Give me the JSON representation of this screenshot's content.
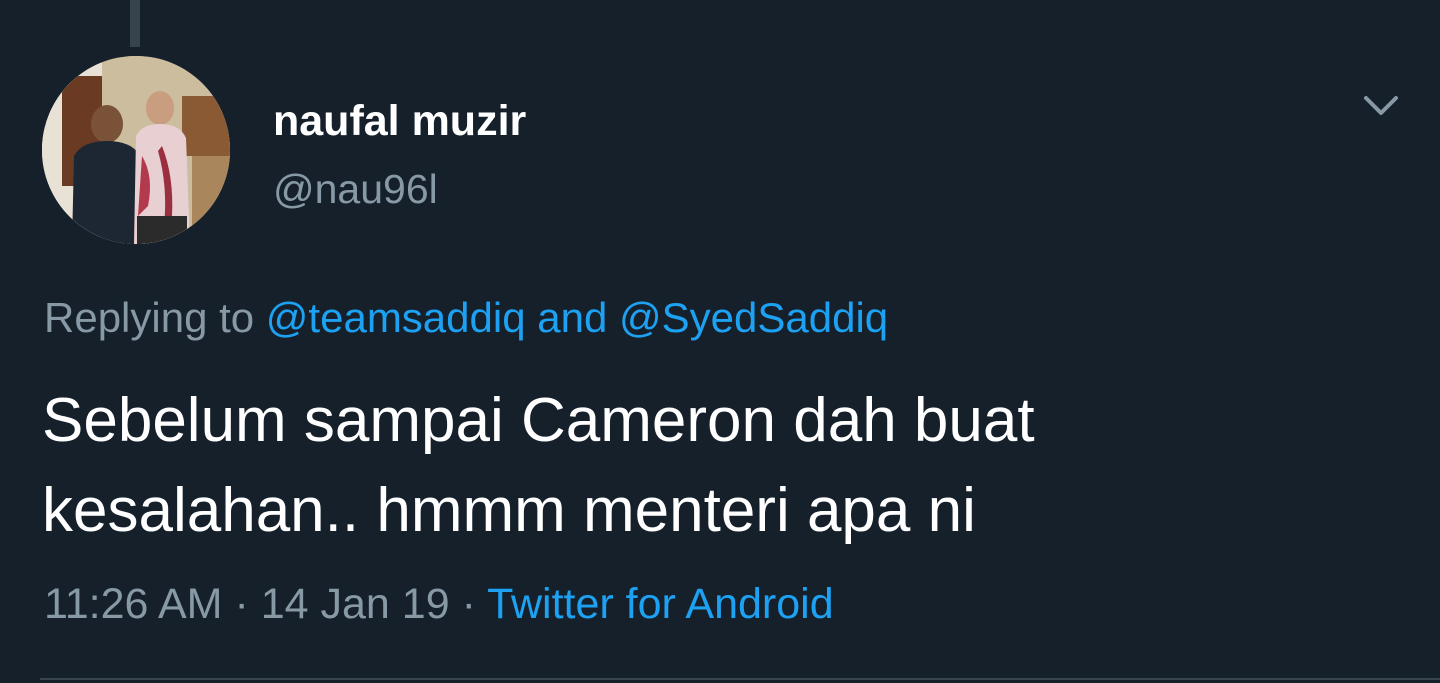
{
  "tweet": {
    "author": {
      "display_name": "naufal muzir",
      "handle": "@nau96l"
    },
    "replying_to": {
      "prefix": "Replying to",
      "users": [
        "@teamsaddiq",
        "@SyedSaddiq"
      ],
      "conjunction": "and"
    },
    "text": "Sebelum sampai Cameron dah buat kesalahan.. hmmm menteri apa ni",
    "meta": {
      "time": "11:26 AM",
      "separator": "·",
      "date": "14 Jan 19",
      "source": "Twitter for Android"
    }
  },
  "icons": {
    "menu": "chevron-down-icon"
  },
  "colors": {
    "background": "#15202b",
    "text": "#ffffff",
    "secondary": "#8899a6",
    "link": "#1da1f2",
    "border": "#38444d"
  }
}
